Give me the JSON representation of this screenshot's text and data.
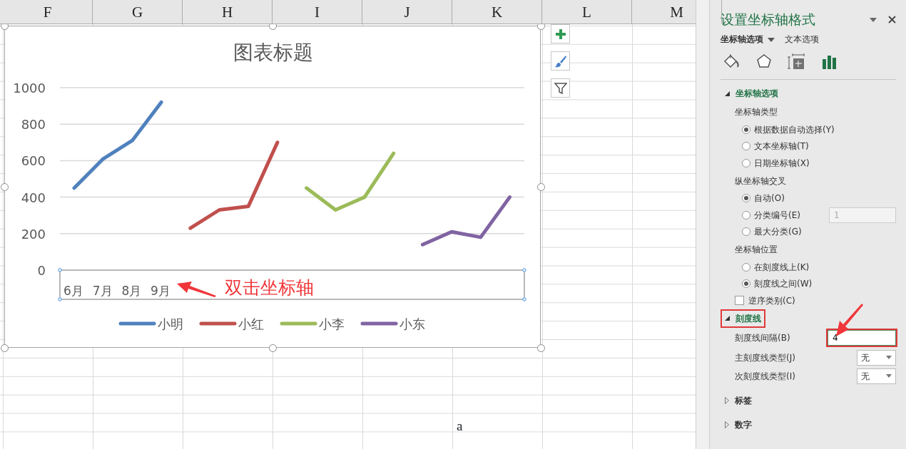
{
  "sheet": {
    "column_headers": [
      "F",
      "G",
      "H",
      "I",
      "J",
      "K",
      "L",
      "M"
    ],
    "cell_text": "a"
  },
  "chart": {
    "title": "图表标题",
    "axis_selected": true,
    "axis_labels": [
      "6月",
      "7月",
      "8月",
      "9月"
    ],
    "chart_data": {
      "type": "line",
      "ylim": [
        0,
        1000
      ],
      "yticks": [
        0,
        200,
        400,
        600,
        800,
        1000
      ],
      "grid": true,
      "legend": "bottom",
      "series": [
        {
          "name": "小明",
          "color": "#4f81bd",
          "values": [
            450,
            610,
            710,
            920,
            null,
            null,
            null,
            null,
            null,
            null,
            null,
            null,
            null,
            null,
            null,
            null
          ]
        },
        {
          "name": "小红",
          "color": "#c0504d",
          "values": [
            null,
            null,
            null,
            null,
            230,
            330,
            350,
            700,
            null,
            null,
            null,
            null,
            null,
            null,
            null,
            null
          ]
        },
        {
          "name": "小李",
          "color": "#9bbb59",
          "values": [
            null,
            null,
            null,
            null,
            null,
            null,
            null,
            null,
            450,
            330,
            400,
            640,
            null,
            null,
            null,
            null
          ]
        },
        {
          "name": "小东",
          "color": "#8064a2",
          "values": [
            null,
            null,
            null,
            null,
            null,
            null,
            null,
            null,
            null,
            null,
            null,
            null,
            140,
            210,
            180,
            400
          ]
        }
      ]
    }
  },
  "annotation": {
    "text": "双击坐标轴"
  },
  "pane": {
    "title": "设置坐标轴格式",
    "tabs": [
      {
        "label": "坐标轴选项",
        "selected": true
      },
      {
        "label": "文本选项",
        "selected": false
      }
    ],
    "icon_tabs": [
      {
        "kind": "fill",
        "selected": false
      },
      {
        "kind": "effects",
        "selected": false
      },
      {
        "kind": "size",
        "selected": false
      },
      {
        "kind": "axis",
        "selected": true
      }
    ],
    "sections": [
      {
        "title": "坐标轴选项",
        "expanded": true,
        "highlighted": false,
        "rows": [
          {
            "kind": "heading",
            "label": "坐标轴类型"
          },
          {
            "kind": "radio",
            "label": "根据数据自动选择(Y)",
            "selected": true
          },
          {
            "kind": "radio",
            "label": "文本坐标轴(T)",
            "selected": false
          },
          {
            "kind": "radio",
            "label": "日期坐标轴(X)",
            "selected": false
          },
          {
            "kind": "heading",
            "label": "纵坐标轴交叉"
          },
          {
            "kind": "radio",
            "label": "自动(O)",
            "selected": true
          },
          {
            "kind": "radio",
            "label": "分类编号(E)",
            "selected": false,
            "value": "1",
            "disabled": true
          },
          {
            "kind": "radio",
            "label": "最大分类(G)",
            "selected": false
          },
          {
            "kind": "heading",
            "label": "坐标轴位置"
          },
          {
            "kind": "radio",
            "label": "在刻度线上(K)",
            "selected": false
          },
          {
            "kind": "radio",
            "label": "刻度线之间(W)",
            "selected": true
          },
          {
            "kind": "checkbox",
            "label": "逆序类别(C)",
            "checked": false
          }
        ]
      },
      {
        "title": "刻度线",
        "expanded": true,
        "highlighted": true,
        "rows": [
          {
            "kind": "input",
            "label": "刻度线间隔(B)",
            "value": "4",
            "highlighted": true
          },
          {
            "kind": "select",
            "label": "主刻度线类型(J)",
            "value": "无"
          },
          {
            "kind": "select",
            "label": "次刻度线类型(I)",
            "value": "无"
          }
        ]
      },
      {
        "title": "标签",
        "expanded": false,
        "highlighted": false
      },
      {
        "title": "数字",
        "expanded": false,
        "highlighted": false
      }
    ]
  }
}
